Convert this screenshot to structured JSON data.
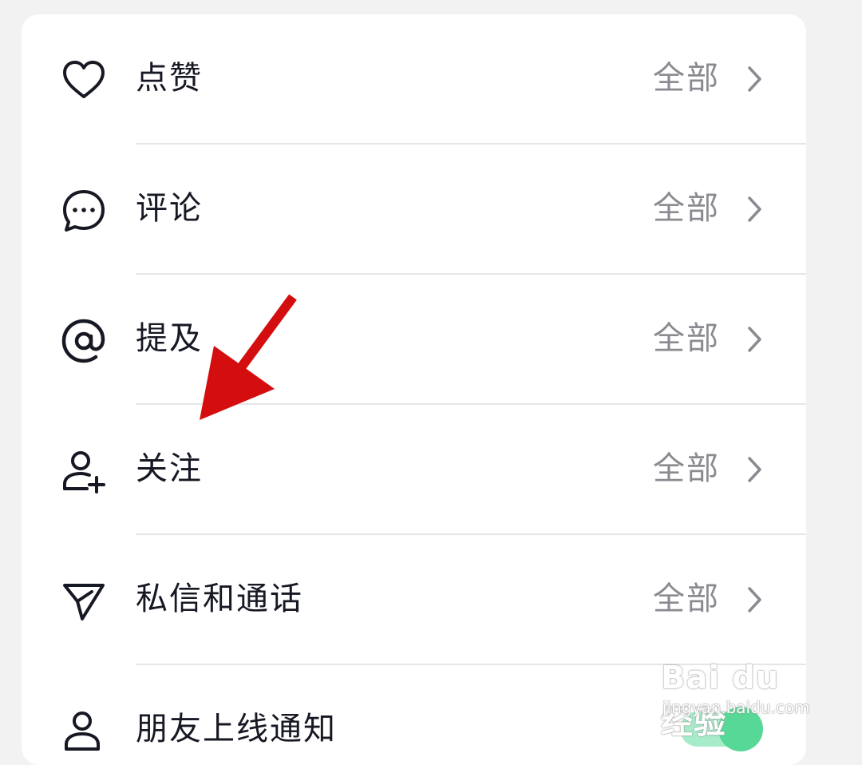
{
  "settings": {
    "rows": [
      {
        "label": "点赞",
        "value": "全部",
        "icon": "heart-icon"
      },
      {
        "label": "评论",
        "value": "全部",
        "icon": "comment-icon"
      },
      {
        "label": "提及",
        "value": "全部",
        "icon": "at-icon"
      },
      {
        "label": "关注",
        "value": "全部",
        "icon": "user-add-icon"
      },
      {
        "label": "私信和通话",
        "value": "全部",
        "icon": "send-icon"
      },
      {
        "label": "朋友上线通知",
        "icon": "user-icon",
        "toggle_on": true
      }
    ]
  },
  "colors": {
    "text": "#161823",
    "secondary": "#8a8b91",
    "toggle_track": "#a6ecca",
    "toggle_knob": "#58d896",
    "annotation_arrow": "#d40e0e"
  },
  "watermark": {
    "main": "Bai du 经验",
    "sub": "jingyan.baidu.com"
  }
}
